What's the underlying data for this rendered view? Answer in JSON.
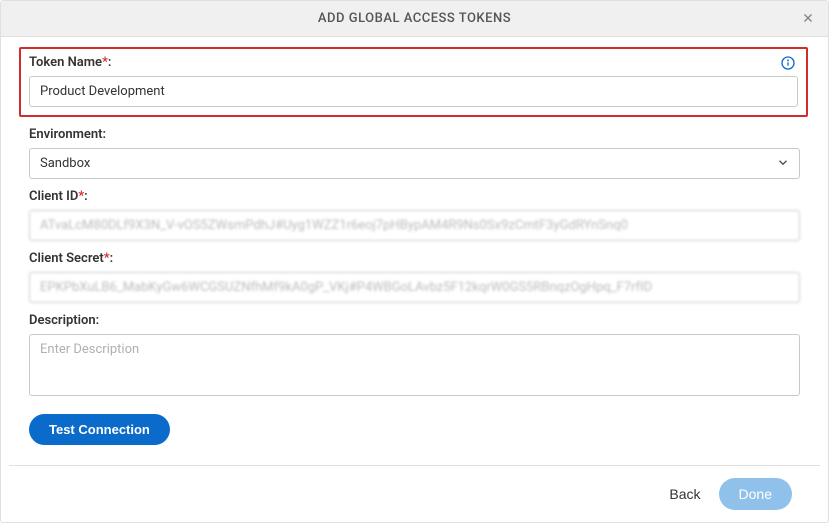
{
  "header": {
    "title": "ADD GLOBAL ACCESS TOKENS"
  },
  "form": {
    "token_name": {
      "label": "Token Name",
      "value": "Product Development"
    },
    "environment": {
      "label": "Environment:",
      "value": "Sandbox"
    },
    "client_id": {
      "label": "Client ID",
      "value": "ATvaLcM80DLf9X3N_V-vOS5ZWsmPdhJ#Uyg1WZZ1r6eoj7pHBypAM4R9Ns0Sx9zCmtF3yGdRYnSnq0"
    },
    "client_secret": {
      "label": "Client Secret",
      "value": "EPKPbXuLB6_MabKyGw6WCGSUZNfhMf9kA0gP_VKj#P4WBGoLAvbz5F12kqrW0GS5RBnqzOgHpq_F7rfID"
    },
    "description": {
      "label": "Description:",
      "placeholder": "Enter Description"
    },
    "test_connection_label": "Test Connection"
  },
  "footer": {
    "back_label": "Back",
    "done_label": "Done"
  }
}
